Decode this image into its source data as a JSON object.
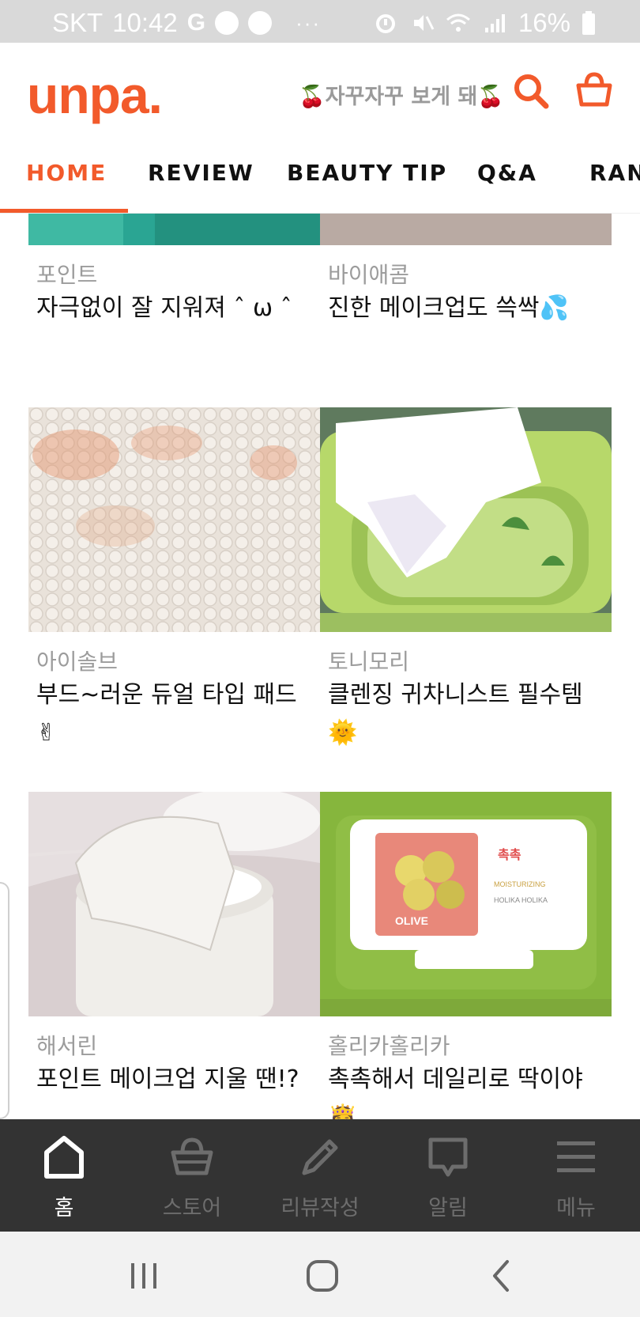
{
  "status_bar": {
    "carrier": "SKT",
    "time": "10:42",
    "g_label": "G",
    "dots": "···",
    "battery": "16%"
  },
  "header": {
    "logo": "unpa.",
    "slogan": "🍒자꾸자꾸 보게 돼🍒",
    "icons": [
      "search-icon",
      "cart-icon"
    ],
    "accent_color": "#f25a2b"
  },
  "tabs": [
    {
      "label": "HOME",
      "active": true
    },
    {
      "label": "REVIEW",
      "active": false
    },
    {
      "label": "BEAUTY TIP",
      "active": false
    },
    {
      "label": "Q&A",
      "active": false
    },
    {
      "label": "RAN",
      "active": false
    }
  ],
  "feed": {
    "cards": [
      {
        "brand": "포인트",
        "title": "자극없이 잘 지워져 ˆ ω ˆ",
        "image": "teal fabric"
      },
      {
        "brand": "바이애콤",
        "title": "진한 메이크업도 쓱싹💦",
        "image": "beige pad"
      },
      {
        "brand": "아이솔브",
        "title": "부드~러운 듀얼 타입 패드✌",
        "image": "makeup stained cotton pad"
      },
      {
        "brand": "토니모리",
        "title": "클렌징 귀차니스트 필수템🌞",
        "image": "green wipe box"
      },
      {
        "brand": "해서린",
        "title": "포인트 메이크업 지울 땐!?",
        "image": "cotton pad jar"
      },
      {
        "brand": "홀리카홀리카",
        "title": "촉촉해서 데일리로 딱이야👸",
        "image": "olive wipes pack"
      }
    ],
    "olive_pack": {
      "label_kr": "촉촉",
      "olive_text": "OLIVE",
      "brand_text": "HOLIKA HOLIKA",
      "moist_text": "MOISTURIZING"
    }
  },
  "bottom_nav": {
    "items": [
      {
        "label": "홈",
        "icon": "home-icon",
        "active": true
      },
      {
        "label": "스토어",
        "icon": "basket-icon",
        "active": false
      },
      {
        "label": "리뷰작성",
        "icon": "pencil-icon",
        "active": false
      },
      {
        "label": "알림",
        "icon": "chat-bubble-icon",
        "active": false
      },
      {
        "label": "메뉴",
        "icon": "menu-icon",
        "active": false
      }
    ]
  },
  "system_nav": {
    "icons": [
      "recents-icon",
      "home-button-icon",
      "back-icon"
    ]
  }
}
